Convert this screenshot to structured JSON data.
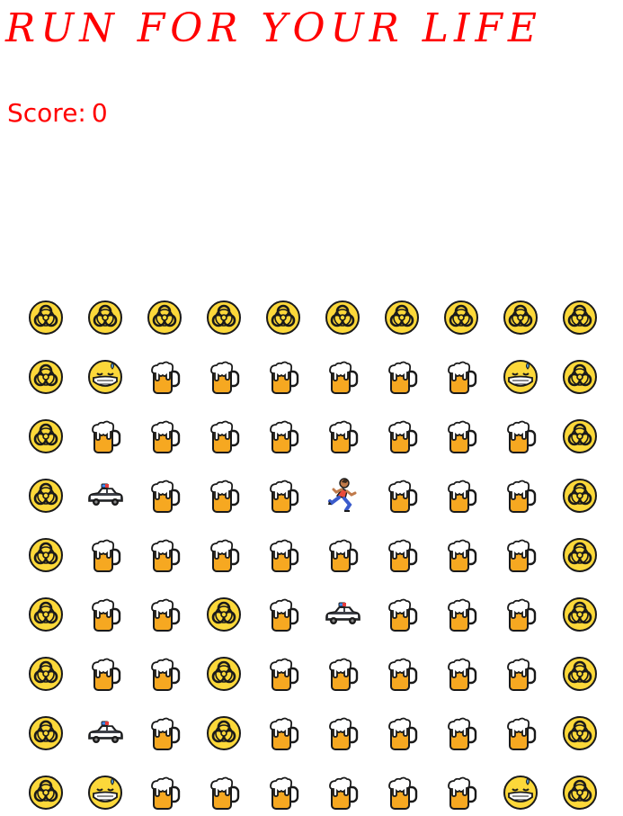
{
  "title": "RUN FOR YOUR LIFE",
  "score": {
    "label": "Score:",
    "value": "0"
  },
  "colors": {
    "accent": "#ff0000",
    "hazard": "#fcd83a",
    "beer": "#f6a821",
    "foam": "#ffffff",
    "car": "#3d4048",
    "runner_shirt": "#e94b3c"
  },
  "legend": {
    "H": "biohazard-icon",
    "B": "beer-mug-icon",
    "F": "masked-face-icon",
    "C": "police-car-icon",
    "R": "runner-icon"
  },
  "board": [
    [
      "H",
      "H",
      "H",
      "H",
      "H",
      "H",
      "H",
      "H",
      "H",
      "H"
    ],
    [
      "H",
      "F",
      "B",
      "B",
      "B",
      "B",
      "B",
      "B",
      "F",
      "H"
    ],
    [
      "H",
      "B",
      "B",
      "B",
      "B",
      "B",
      "B",
      "B",
      "B",
      "H"
    ],
    [
      "H",
      "C",
      "B",
      "B",
      "B",
      "R",
      "B",
      "B",
      "B",
      "H"
    ],
    [
      "H",
      "B",
      "B",
      "B",
      "B",
      "B",
      "B",
      "B",
      "B",
      "H"
    ],
    [
      "H",
      "B",
      "B",
      "H",
      "B",
      "C",
      "B",
      "B",
      "B",
      "H"
    ],
    [
      "H",
      "B",
      "B",
      "H",
      "B",
      "B",
      "B",
      "B",
      "B",
      "H"
    ],
    [
      "H",
      "C",
      "B",
      "H",
      "B",
      "B",
      "B",
      "B",
      "B",
      "H"
    ],
    [
      "H",
      "F",
      "B",
      "B",
      "B",
      "B",
      "B",
      "B",
      "F",
      "H"
    ]
  ]
}
